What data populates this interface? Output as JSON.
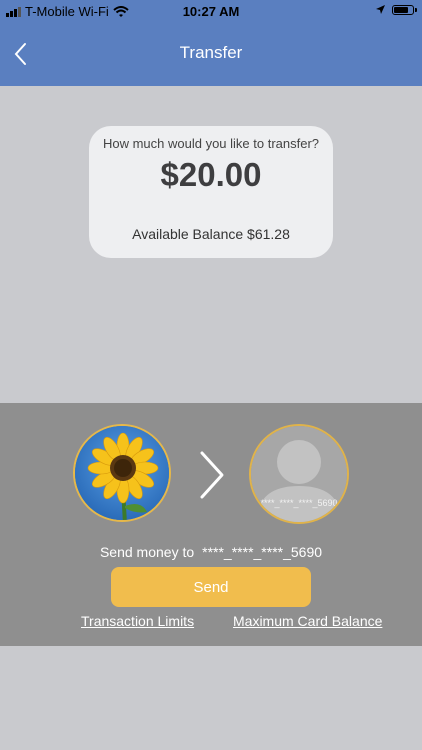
{
  "status_bar": {
    "carrier": "T-Mobile Wi-Fi",
    "time": "10:27 AM"
  },
  "nav": {
    "title": "Transfer"
  },
  "amount_card": {
    "question": "How much would you like to transfer?",
    "amount": "$20.00",
    "available_balance": "Available Balance $61.28"
  },
  "transfer": {
    "recipient_masked": "****_****_****_5690",
    "send_money_label": "Send money to",
    "send_button": "Send",
    "transaction_limits_link": "Transaction Limits",
    "max_card_balance_link": "Maximum Card Balance"
  },
  "colors": {
    "nav_bg": "#5a7fc0",
    "page_bg": "#c9cace",
    "panel_bg": "#8f8f8f",
    "accent": "#f1bd4d"
  },
  "icons": [
    "signal-icon",
    "wifi-icon",
    "location-icon",
    "battery-icon",
    "back-chevron-icon",
    "sunflower-avatar",
    "chevron-right-icon",
    "placeholder-person-avatar"
  ]
}
